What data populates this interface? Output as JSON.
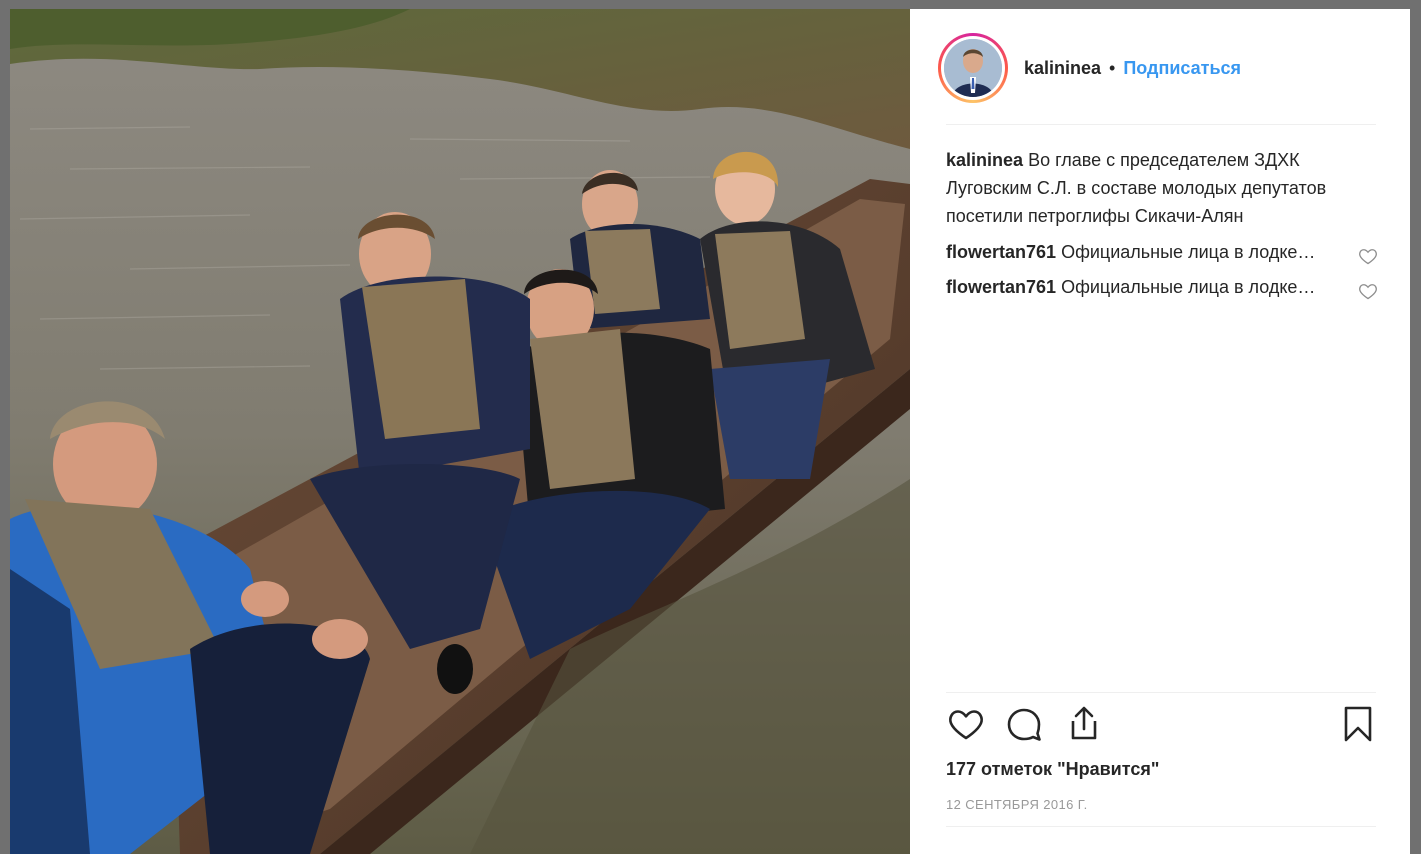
{
  "post": {
    "username": "kalininea",
    "separator": "•",
    "follow_label": "Подписаться",
    "caption_author": "kalininea",
    "caption_text": "Во главе с председателем ЗДХК Луговским С.Л. в составе молодых депутатов посетили петроглифы Сикачи-Алян",
    "comments": [
      {
        "author": "flowertan761",
        "text": "Официальные лица в лодке…"
      },
      {
        "author": "flowertan761",
        "text": "Официальные лица в лодке…"
      }
    ],
    "likes_label": "177 отметок \"Нравится\"",
    "date": "12 сентября 2016 г."
  },
  "icons": {
    "like": "heart-outline-icon",
    "comment": "speech-bubble-icon",
    "share": "share-upload-icon",
    "save": "bookmark-icon",
    "comment_like": "small-heart-icon"
  },
  "colors": {
    "link": "#3897f0",
    "text": "#262626",
    "muted": "#999999",
    "divider": "#efefef"
  }
}
